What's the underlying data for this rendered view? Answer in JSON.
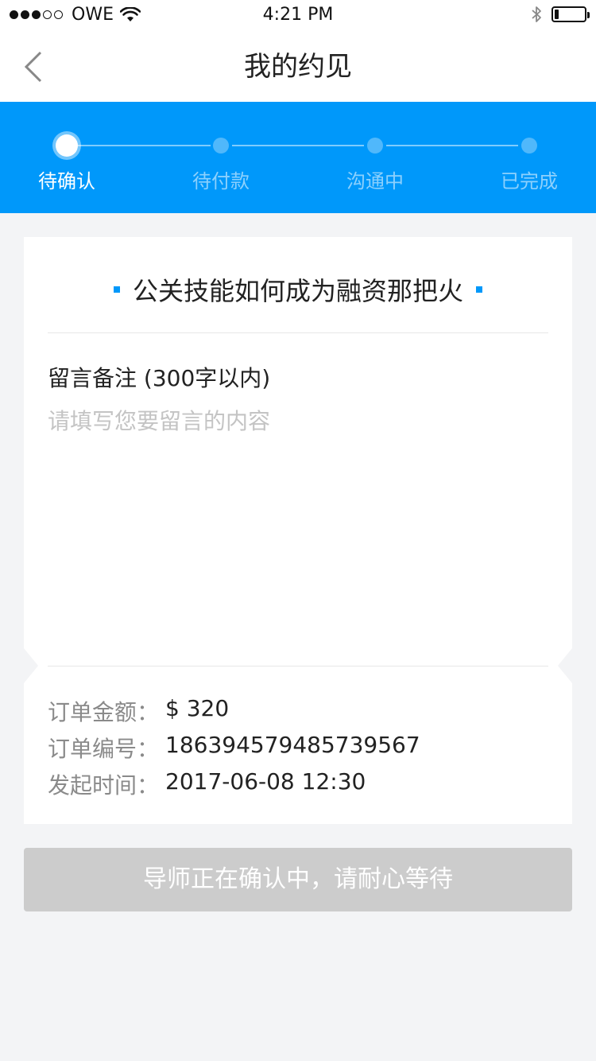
{
  "status_bar": {
    "carrier": "OWE",
    "time": "4:21 PM",
    "signal_bars_filled": 3,
    "signal_bars_total": 5,
    "battery_level": 0.15,
    "icons": [
      "wifi-icon",
      "bluetooth-icon",
      "battery-icon"
    ]
  },
  "nav": {
    "title": "我的约见",
    "back_icon": "chevron-left-icon"
  },
  "progress": {
    "steps": [
      {
        "label": "待确认",
        "active": true
      },
      {
        "label": "待付款",
        "active": false
      },
      {
        "label": "沟通中",
        "active": false
      },
      {
        "label": "已完成",
        "active": false
      }
    ]
  },
  "card": {
    "topic_title": "公关技能如何成为融资那把火",
    "note_label": "留言备注 (300字以内)",
    "note_placeholder": "请填写您要留言的内容",
    "note_value": "",
    "info": [
      {
        "label": "订单金额：",
        "value": "$ 320"
      },
      {
        "label": "订单编号：",
        "value": "186394579485739567"
      },
      {
        "label": "发起时间：",
        "value": "2017-06-08  12:30"
      }
    ]
  },
  "action": {
    "button_label": "导师正在确认中，请耐心等待"
  },
  "colors": {
    "accent": "#0098fa",
    "background": "#f3f4f6",
    "button_disabled": "#cccccc",
    "placeholder": "#c4c4c4",
    "label_gray": "#8a8a8a"
  }
}
